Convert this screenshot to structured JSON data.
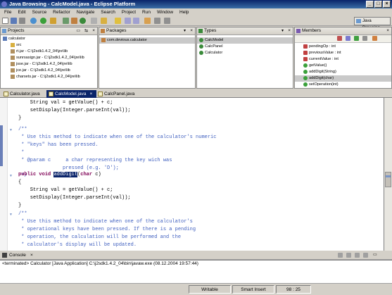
{
  "window": {
    "title": "Java Browsing - CalcModel.java - Eclipse Platform"
  },
  "menu": [
    "File",
    "Edit",
    "Source",
    "Refactor",
    "Navigate",
    "Search",
    "Project",
    "Run",
    "Window",
    "Help"
  ],
  "perspective": {
    "label": "Java Browsing"
  },
  "views": {
    "projects": {
      "title": "Projects",
      "items": [
        {
          "label": "calculator",
          "icon": "project-icon"
        },
        {
          "label": "src",
          "icon": "source-folder-icon"
        },
        {
          "label": "rt.jar - C:\\j2sdk1.4.2_04\\jre\\lib",
          "icon": "jar-icon"
        },
        {
          "label": "sunrsasign.jar - C:\\j2sdk1.4.2_04\\jre\\lib",
          "icon": "jar-icon"
        },
        {
          "label": "jsse.jar - C:\\j2sdk1.4.2_04\\jre\\lib",
          "icon": "jar-icon"
        },
        {
          "label": "jce.jar - C:\\j2sdk1.4.2_04\\jre\\lib",
          "icon": "jar-icon"
        },
        {
          "label": "charsets.jar - C:\\j2sdk1.4.2_04\\jre\\lib",
          "icon": "jar-icon"
        }
      ]
    },
    "packages": {
      "title": "Packages",
      "items": [
        {
          "label": "com.devious.calculator",
          "icon": "package-icon"
        }
      ]
    },
    "types": {
      "title": "Types",
      "items": [
        {
          "label": "CalcModel",
          "icon": "class-icon"
        },
        {
          "label": "CalcPanel",
          "icon": "class-icon"
        },
        {
          "label": "Calculator",
          "icon": "class-icon"
        }
      ]
    },
    "members": {
      "title": "Members",
      "items": [
        {
          "label": "pendingOp : int",
          "icon": "private-field-icon"
        },
        {
          "label": "previousValue : int",
          "icon": "private-field-icon"
        },
        {
          "label": "currentValue : int",
          "icon": "private-field-icon"
        },
        {
          "label": "getValue()",
          "icon": "public-method-icon"
        },
        {
          "label": "addDigit(String)",
          "icon": "public-method-icon"
        },
        {
          "label": "addDigit(char)",
          "icon": "public-method-icon"
        },
        {
          "label": "setOperation(int)",
          "icon": "public-method-icon"
        }
      ]
    }
  },
  "editor": {
    "tabs": [
      {
        "label": "Calculator.java",
        "active": false
      },
      {
        "label": "CalcModel.java",
        "active": true
      },
      {
        "label": "CalcPanel.java",
        "active": false
      }
    ]
  },
  "console": {
    "title": "Console",
    "line": "<terminated> Calculator [Java Application] C:\\j2sdk1.4.2_04\\bin\\javaw.exe (08.12.2004 19:57:44)"
  },
  "status": {
    "writable": "Writable",
    "insert_mode": "Smart Insert",
    "position": "98 : 25"
  },
  "colors": {
    "titlebar": "#0a246a",
    "keyword": "#7f0055",
    "comment": "#3f5fbf",
    "selection": "#0a246a"
  }
}
